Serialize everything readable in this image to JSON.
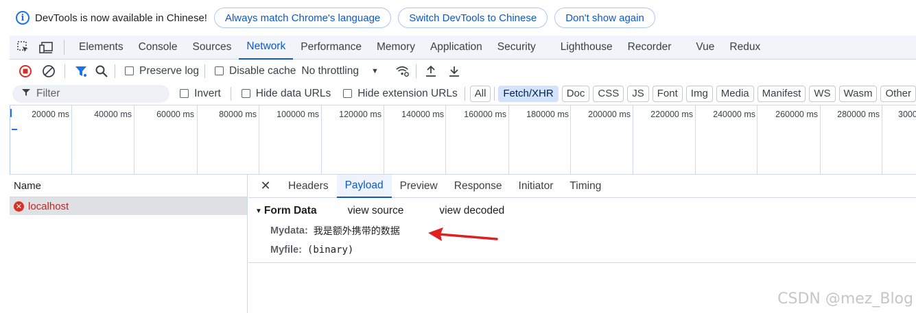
{
  "infobar": {
    "icon": "info-icon",
    "message": "DevTools is now available in Chinese!",
    "buttons": [
      "Always match Chrome's language",
      "Switch DevTools to Chinese",
      "Don't show again"
    ]
  },
  "tabs": {
    "items": [
      "Elements",
      "Console",
      "Sources",
      "Network",
      "Performance",
      "Memory",
      "Application",
      "Security",
      "Lighthouse",
      "Recorder",
      "Vue",
      "Redux"
    ],
    "active": "Network"
  },
  "toolbar": {
    "preserve_log": "Preserve log",
    "disable_cache": "Disable cache",
    "throttling": "No throttling"
  },
  "filterbar": {
    "placeholder": "Filter",
    "invert": "Invert",
    "hide_data_urls": "Hide data URLs",
    "hide_extension_urls": "Hide extension URLs",
    "types": [
      "All",
      "Fetch/XHR",
      "Doc",
      "CSS",
      "JS",
      "Font",
      "Img",
      "Media",
      "Manifest",
      "WS",
      "Wasm",
      "Other"
    ],
    "active_type": "Fetch/XHR"
  },
  "timeline": {
    "ticks": [
      "20000 ms",
      "40000 ms",
      "60000 ms",
      "80000 ms",
      "100000 ms",
      "120000 ms",
      "140000 ms",
      "160000 ms",
      "180000 ms",
      "200000 ms",
      "220000 ms",
      "240000 ms",
      "260000 ms",
      "280000 ms",
      "3000"
    ]
  },
  "requests": {
    "header": "Name",
    "rows": [
      "localhost"
    ]
  },
  "details": {
    "tabs": [
      "Headers",
      "Payload",
      "Preview",
      "Response",
      "Initiator",
      "Timing"
    ],
    "active": "Payload",
    "form_data": {
      "title": "Form Data",
      "view_source": "view source",
      "view_decoded": "view decoded",
      "fields": [
        {
          "key": "Mydata:",
          "value": "我是额外携带的数据"
        },
        {
          "key": "Myfile:",
          "value": "(binary)"
        }
      ]
    }
  },
  "annotation": {
    "color": "#e02020"
  },
  "watermark": "CSDN @mez_Blog"
}
